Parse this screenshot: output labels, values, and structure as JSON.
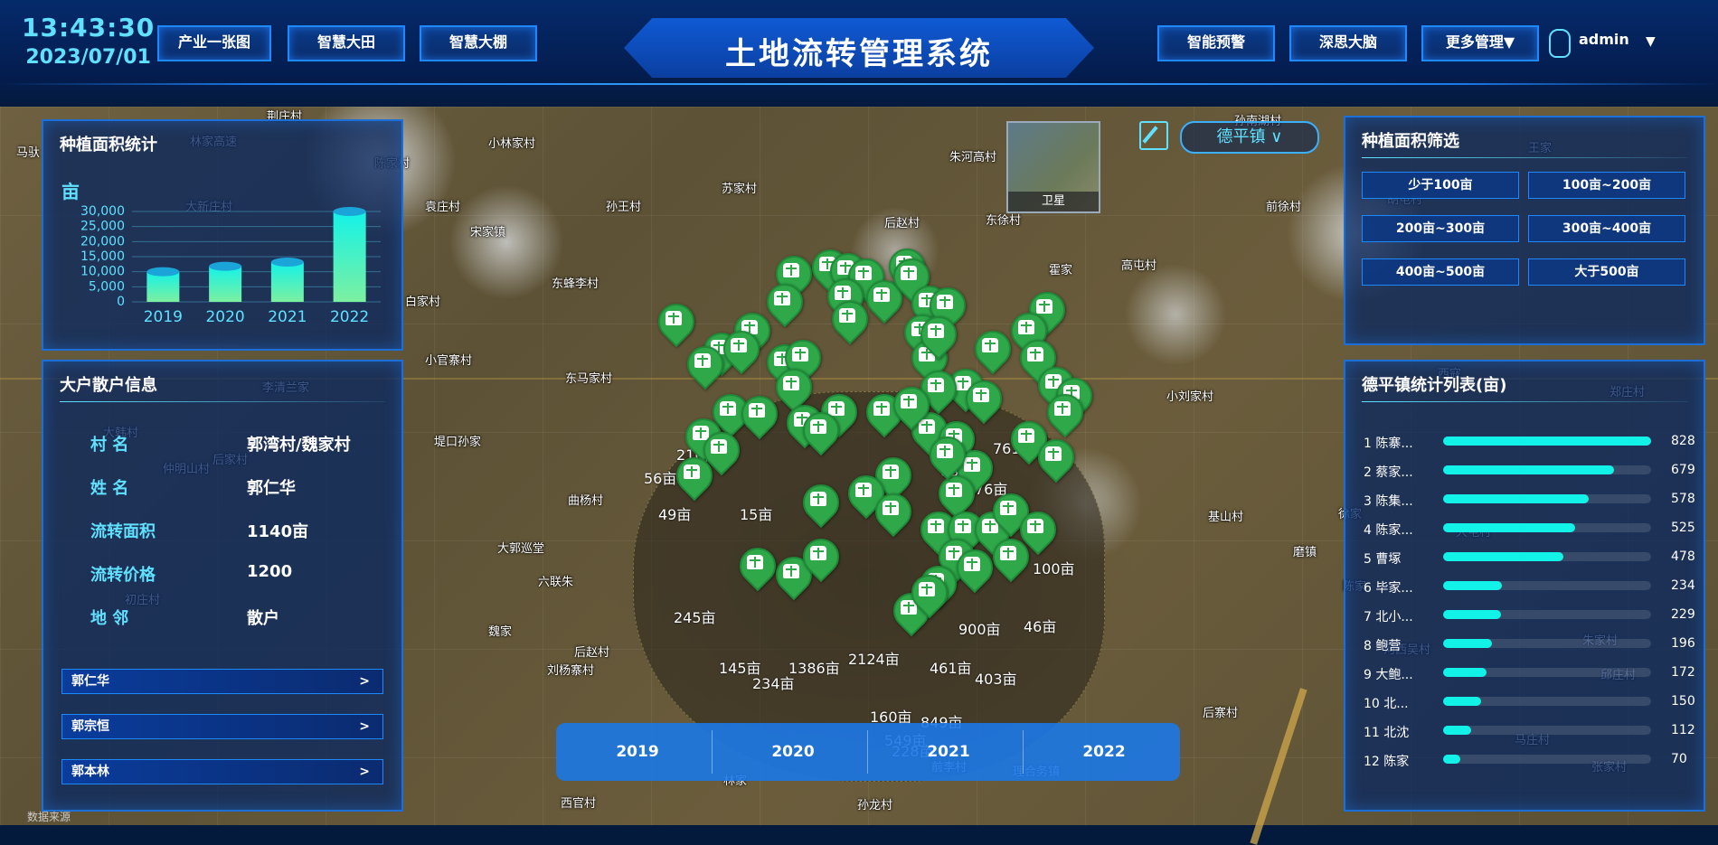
{
  "header": {
    "time": "13:43:30",
    "date": "2023/07/01",
    "title": "土地流转管理系统",
    "left_nav": [
      "产业一张图",
      "智慧大田",
      "智慧大棚"
    ],
    "right_nav": [
      "智能预警",
      "深思大脑",
      "更多管理▼"
    ],
    "user": "admin",
    "user_caret": "▼"
  },
  "map": {
    "town_select": "德平镇 ∨",
    "satellite_label": "卫星",
    "towns": [
      "荆庄村",
      "马驮",
      "林家高速",
      "小林家村",
      "朱河高村",
      "孙南湖村",
      "王家",
      "苏家村",
      "孙王村",
      "后赵村",
      "东徐村",
      "前徐村",
      "胡屯村",
      "宋家镇",
      "大新庄村",
      "袁庄村",
      "陈家村",
      "霍家",
      "高屯村",
      "东蜂李村",
      "白家村",
      "张宝山村",
      "小官寨村",
      "东马家村",
      "小刘家村",
      "西寇",
      "李清兰家",
      "堤口孙家",
      "大韩村",
      "后家村",
      "曲杨村",
      "基山村",
      "徐家",
      "大郭巡堂",
      "磨镇",
      "六联朱",
      "前李村",
      "后赵村",
      "刘杨寨村",
      "后寨村",
      "河西吴村",
      "朱家村",
      "西官村",
      "孙龙村",
      "理合务镇",
      "林家",
      "魏家",
      "仲明山村",
      "初庄村",
      "郑庄村",
      "大屯村",
      "陈家",
      "张家村",
      "邱庄村",
      "马庄村"
    ],
    "labels": [
      "210亩",
      "56亩",
      "49亩",
      "15亩",
      "834亩",
      "76亩",
      "761亩",
      "100亩",
      "245亩",
      "145亩",
      "234亩",
      "1386亩",
      "2124亩",
      "900亩",
      "46亩",
      "160亩",
      "849亩",
      "549亩",
      "228亩",
      "403亩",
      "461亩"
    ],
    "footer": "数据来源"
  },
  "planting_stats": {
    "title": "种植面积统计",
    "unit": "亩",
    "chart_data": {
      "type": "bar",
      "categories": [
        "2019",
        "2020",
        "2021",
        "2022"
      ],
      "values": [
        10000,
        11800,
        13200,
        30000
      ],
      "ylabel": "亩",
      "ylim": [
        0,
        30000
      ],
      "yticks": [
        "30,000",
        "25,000",
        "20,000",
        "15,000",
        "10,000",
        "5,000",
        "0"
      ]
    }
  },
  "big_farmer": {
    "title": "大户散户信息",
    "rows": [
      {
        "k": "村 名",
        "v": "郭湾村/魏家村"
      },
      {
        "k": "姓 名",
        "v": "郭仁华"
      },
      {
        "k": "流转面积",
        "v": "1140亩"
      },
      {
        "k": "流转价格",
        "v": "1200"
      },
      {
        "k": "地 邻",
        "v": "散户"
      }
    ],
    "list": [
      {
        "name": "郭仁华",
        "chev": ">"
      },
      {
        "name": "郭宗恒",
        "chev": ">"
      },
      {
        "name": "郭本林",
        "chev": ">"
      }
    ]
  },
  "area_filter": {
    "title": "种植面积筛选",
    "options": [
      "少于100亩",
      "100亩~200亩",
      "200亩~300亩",
      "300亩~400亩",
      "400亩~500亩",
      "大于500亩"
    ]
  },
  "town_stats": {
    "title": "德平镇统计列表(亩)",
    "max": 828,
    "items": [
      {
        "label": "1 陈寨...",
        "value": 828
      },
      {
        "label": "2 蔡家...",
        "value": 679
      },
      {
        "label": "3 陈集...",
        "value": 578
      },
      {
        "label": "4 陈家...",
        "value": 525
      },
      {
        "label": "5 曹塚",
        "value": 478
      },
      {
        "label": "6 毕家...",
        "value": 234
      },
      {
        "label": "7 北小...",
        "value": 229
      },
      {
        "label": "8 鲍营",
        "value": 196
      },
      {
        "label": "9 大鲍...",
        "value": 172
      },
      {
        "label": "10 北...",
        "value": 150
      },
      {
        "label": "11 北沈",
        "value": 112
      },
      {
        "label": "12 陈家",
        "value": 70
      }
    ]
  },
  "timeline": {
    "years": [
      "2019",
      "2020",
      "2021",
      "2022"
    ]
  }
}
